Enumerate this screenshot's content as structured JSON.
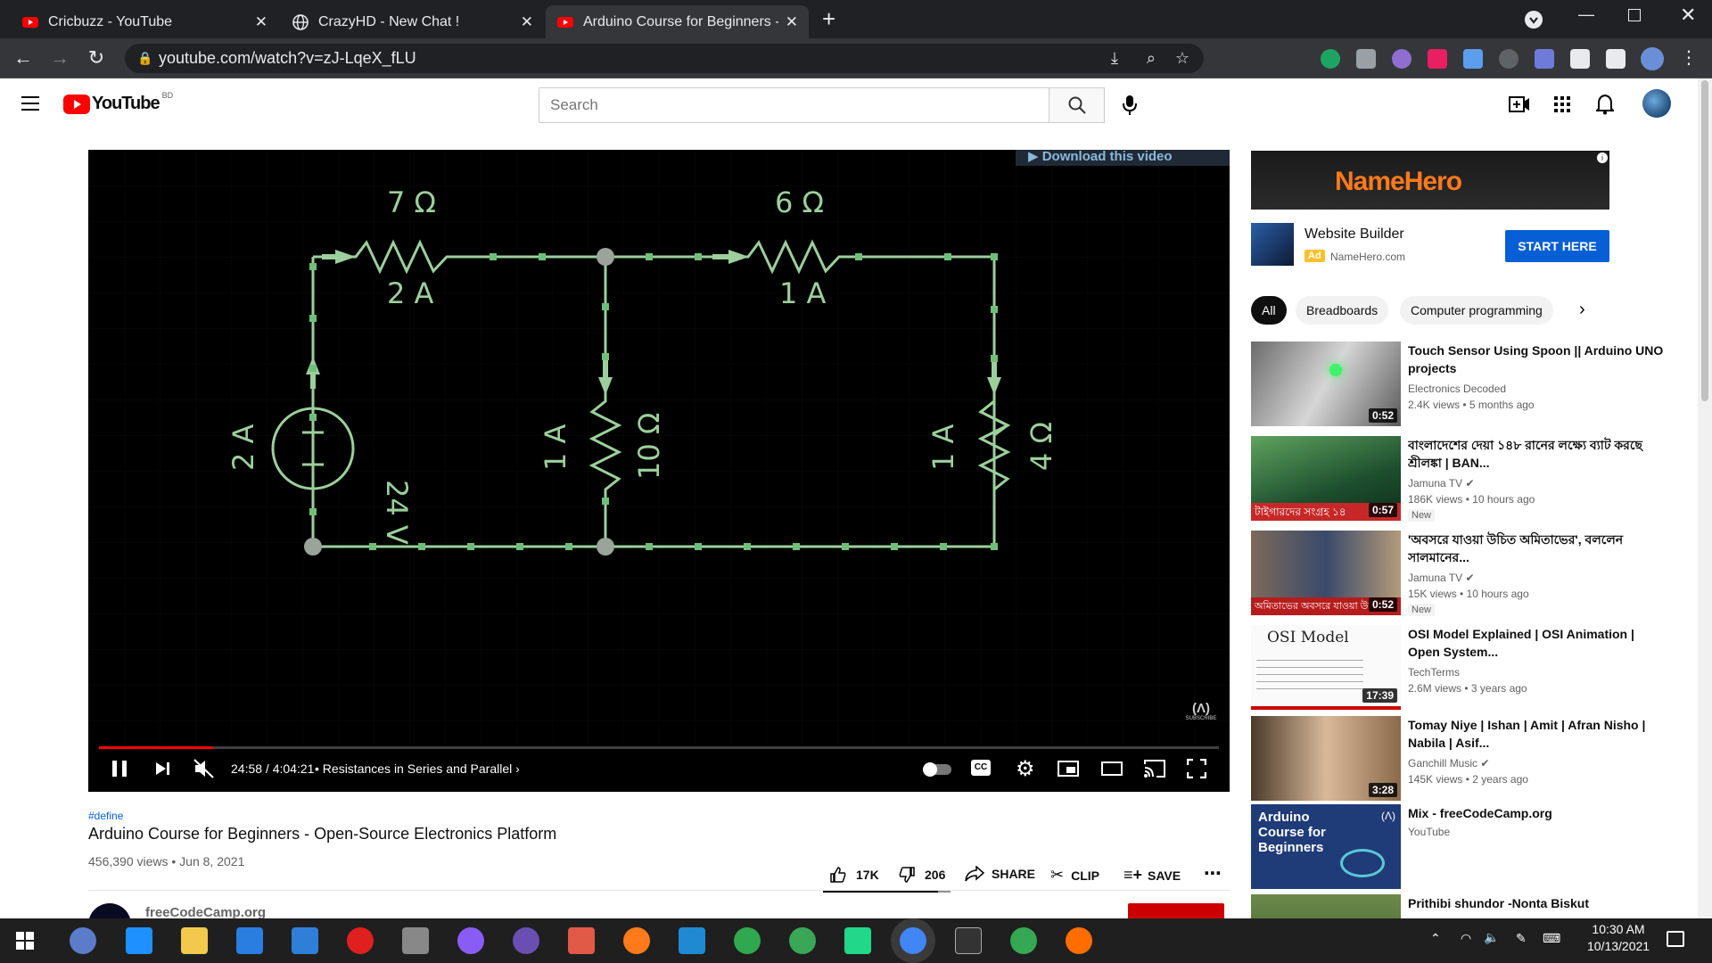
{
  "tabs": [
    {
      "title": "Cricbuzz - YouTube",
      "active": false
    },
    {
      "title": "CrazyHD - New Chat !",
      "active": false
    },
    {
      "title": "Arduino Course for Beginners - O",
      "active": true
    }
  ],
  "address": {
    "url": "youtube.com/watch?v=zJ-LqeX_fLU"
  },
  "masthead": {
    "logo": "YouTube",
    "region": "BD",
    "search_placeholder": "Search"
  },
  "video": {
    "time": "24:58 / 4:04:21",
    "chapter": "Resistances in Series and Parallel",
    "download_label": "Download this video",
    "watermark": "SUBSCRIBE",
    "progress_fraction": 0.102,
    "circuit": {
      "r1": "7 Ω",
      "i1": "2 A",
      "r2": "6 Ω",
      "i2": "1 A",
      "src_i": "2 A",
      "src_v": "24 V",
      "i3": "1 A",
      "r3": "10 Ω",
      "i4": "1 A",
      "r4": "4 Ω"
    }
  },
  "meta": {
    "hashtag": "#define",
    "title": "Arduino Course for Beginners - Open-Source Electronics Platform",
    "stats": "456,390 views • Jun 8, 2021",
    "likes": "17K",
    "dislikes": "206",
    "share": "SHARE",
    "clip": "CLIP",
    "save": "SAVE",
    "channel": "freeCodeCamp.org"
  },
  "ad": {
    "brand": "NameHero",
    "title": "Website Builder",
    "label": "Ad",
    "site": "NameHero.com",
    "cta": "START HERE"
  },
  "chips": [
    "All",
    "Breadboards",
    "Computer programming"
  ],
  "recs": [
    {
      "title": "Touch Sensor Using Spoon || Arduino UNO projects",
      "channel": "Electronics Decoded",
      "stats": "2.4K views • 5 months ago",
      "duration": "0:52",
      "badge": ""
    },
    {
      "title": "বাংলাদেশের দেয়া ১৪৮ রানের লক্ষ্যে ব্যাট করছে শ্রীলঙ্কা | BAN...",
      "channel": "Jamuna TV",
      "stats": "186K views • 10 hours ago",
      "duration": "0:57",
      "badge": "New",
      "thumb_text": "টাইগারদের সংগ্রহ ১৪"
    },
    {
      "title": "'অবসরে যাওয়া উচিত অমিতাভের', বললেন সালমানের...",
      "channel": "Jamuna TV",
      "stats": "15K views • 10 hours ago",
      "duration": "0:52",
      "badge": "New",
      "thumb_text": "অমিতাভের অবসরে যাওয়া উ"
    },
    {
      "title": "OSI Model Explained | OSI Animation | Open System...",
      "channel": "TechTerms",
      "stats": "2.6M views • 3 years ago",
      "duration": "17:39",
      "badge": "",
      "thumb_text": "OSI Model"
    },
    {
      "title": "Tomay Niye | Ishan | Amit | Afran Nisho | Nabila | Asif...",
      "channel": "Ganchill Music",
      "stats": "145K views • 2 years ago",
      "duration": "3:28",
      "badge": ""
    },
    {
      "title": "Mix - freeCodeCamp.org",
      "channel": "YouTube",
      "stats": "",
      "duration": "",
      "badge": "",
      "thumb_text": "Arduino Course for Beginners"
    },
    {
      "title": "Prithibi shundor -Nonta Biskut",
      "channel": "",
      "stats": "",
      "duration": "",
      "badge": ""
    }
  ],
  "taskbar": {
    "time": "10:30 AM",
    "date": "10/13/2021"
  }
}
